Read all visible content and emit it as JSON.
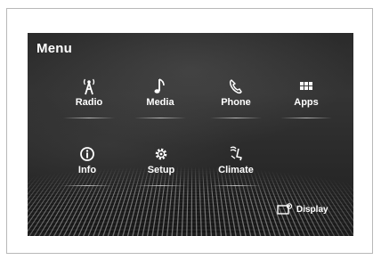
{
  "menu": {
    "title": "Menu"
  },
  "tiles": [
    {
      "label": "Radio",
      "icon": "radio-antenna-icon"
    },
    {
      "label": "Media",
      "icon": "music-note-icon"
    },
    {
      "label": "Phone",
      "icon": "phone-icon"
    },
    {
      "label": "Apps",
      "icon": "apps-grid-icon"
    },
    {
      "label": "Info",
      "icon": "info-icon"
    },
    {
      "label": "Setup",
      "icon": "gear-icon"
    },
    {
      "label": "Climate",
      "icon": "climate-seat-icon"
    }
  ],
  "display_button": {
    "label": "Display",
    "icon": "display-icon"
  }
}
